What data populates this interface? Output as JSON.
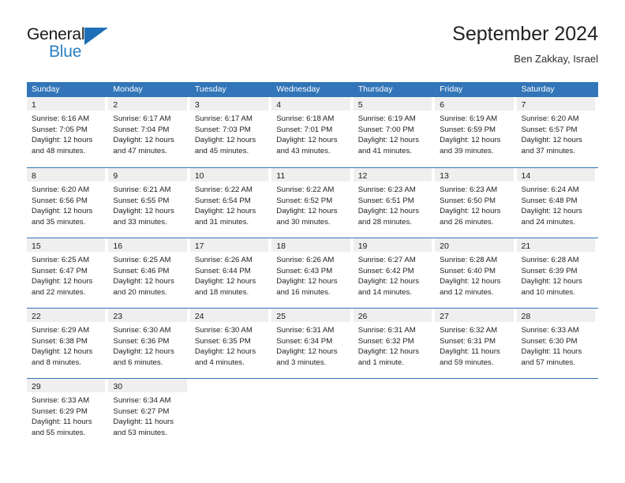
{
  "logo": {
    "word_top": "General",
    "word_bottom": "Blue",
    "triangle_color": "#1e6fb8",
    "blue_text_color": "#2980c4"
  },
  "header": {
    "title": "September 2024",
    "subtitle": "Ben Zakkay, Israel"
  },
  "theme": {
    "header_blue": "#3275b8",
    "daynum_band": "#efefef",
    "text": "#222222"
  },
  "calendar": {
    "day_headers": [
      "Sunday",
      "Monday",
      "Tuesday",
      "Wednesday",
      "Thursday",
      "Friday",
      "Saturday"
    ],
    "weeks": [
      [
        {
          "day": "1",
          "lines": [
            "Sunrise: 6:16 AM",
            "Sunset: 7:05 PM",
            "Daylight: 12 hours",
            "and 48 minutes."
          ]
        },
        {
          "day": "2",
          "lines": [
            "Sunrise: 6:17 AM",
            "Sunset: 7:04 PM",
            "Daylight: 12 hours",
            "and 47 minutes."
          ]
        },
        {
          "day": "3",
          "lines": [
            "Sunrise: 6:17 AM",
            "Sunset: 7:03 PM",
            "Daylight: 12 hours",
            "and 45 minutes."
          ]
        },
        {
          "day": "4",
          "lines": [
            "Sunrise: 6:18 AM",
            "Sunset: 7:01 PM",
            "Daylight: 12 hours",
            "and 43 minutes."
          ]
        },
        {
          "day": "5",
          "lines": [
            "Sunrise: 6:19 AM",
            "Sunset: 7:00 PM",
            "Daylight: 12 hours",
            "and 41 minutes."
          ]
        },
        {
          "day": "6",
          "lines": [
            "Sunrise: 6:19 AM",
            "Sunset: 6:59 PM",
            "Daylight: 12 hours",
            "and 39 minutes."
          ]
        },
        {
          "day": "7",
          "lines": [
            "Sunrise: 6:20 AM",
            "Sunset: 6:57 PM",
            "Daylight: 12 hours",
            "and 37 minutes."
          ]
        }
      ],
      [
        {
          "day": "8",
          "lines": [
            "Sunrise: 6:20 AM",
            "Sunset: 6:56 PM",
            "Daylight: 12 hours",
            "and 35 minutes."
          ]
        },
        {
          "day": "9",
          "lines": [
            "Sunrise: 6:21 AM",
            "Sunset: 6:55 PM",
            "Daylight: 12 hours",
            "and 33 minutes."
          ]
        },
        {
          "day": "10",
          "lines": [
            "Sunrise: 6:22 AM",
            "Sunset: 6:54 PM",
            "Daylight: 12 hours",
            "and 31 minutes."
          ]
        },
        {
          "day": "11",
          "lines": [
            "Sunrise: 6:22 AM",
            "Sunset: 6:52 PM",
            "Daylight: 12 hours",
            "and 30 minutes."
          ]
        },
        {
          "day": "12",
          "lines": [
            "Sunrise: 6:23 AM",
            "Sunset: 6:51 PM",
            "Daylight: 12 hours",
            "and 28 minutes."
          ]
        },
        {
          "day": "13",
          "lines": [
            "Sunrise: 6:23 AM",
            "Sunset: 6:50 PM",
            "Daylight: 12 hours",
            "and 26 minutes."
          ]
        },
        {
          "day": "14",
          "lines": [
            "Sunrise: 6:24 AM",
            "Sunset: 6:48 PM",
            "Daylight: 12 hours",
            "and 24 minutes."
          ]
        }
      ],
      [
        {
          "day": "15",
          "lines": [
            "Sunrise: 6:25 AM",
            "Sunset: 6:47 PM",
            "Daylight: 12 hours",
            "and 22 minutes."
          ]
        },
        {
          "day": "16",
          "lines": [
            "Sunrise: 6:25 AM",
            "Sunset: 6:46 PM",
            "Daylight: 12 hours",
            "and 20 minutes."
          ]
        },
        {
          "day": "17",
          "lines": [
            "Sunrise: 6:26 AM",
            "Sunset: 6:44 PM",
            "Daylight: 12 hours",
            "and 18 minutes."
          ]
        },
        {
          "day": "18",
          "lines": [
            "Sunrise: 6:26 AM",
            "Sunset: 6:43 PM",
            "Daylight: 12 hours",
            "and 16 minutes."
          ]
        },
        {
          "day": "19",
          "lines": [
            "Sunrise: 6:27 AM",
            "Sunset: 6:42 PM",
            "Daylight: 12 hours",
            "and 14 minutes."
          ]
        },
        {
          "day": "20",
          "lines": [
            "Sunrise: 6:28 AM",
            "Sunset: 6:40 PM",
            "Daylight: 12 hours",
            "and 12 minutes."
          ]
        },
        {
          "day": "21",
          "lines": [
            "Sunrise: 6:28 AM",
            "Sunset: 6:39 PM",
            "Daylight: 12 hours",
            "and 10 minutes."
          ]
        }
      ],
      [
        {
          "day": "22",
          "lines": [
            "Sunrise: 6:29 AM",
            "Sunset: 6:38 PM",
            "Daylight: 12 hours",
            "and 8 minutes."
          ]
        },
        {
          "day": "23",
          "lines": [
            "Sunrise: 6:30 AM",
            "Sunset: 6:36 PM",
            "Daylight: 12 hours",
            "and 6 minutes."
          ]
        },
        {
          "day": "24",
          "lines": [
            "Sunrise: 6:30 AM",
            "Sunset: 6:35 PM",
            "Daylight: 12 hours",
            "and 4 minutes."
          ]
        },
        {
          "day": "25",
          "lines": [
            "Sunrise: 6:31 AM",
            "Sunset: 6:34 PM",
            "Daylight: 12 hours",
            "and 3 minutes."
          ]
        },
        {
          "day": "26",
          "lines": [
            "Sunrise: 6:31 AM",
            "Sunset: 6:32 PM",
            "Daylight: 12 hours",
            "and 1 minute."
          ]
        },
        {
          "day": "27",
          "lines": [
            "Sunrise: 6:32 AM",
            "Sunset: 6:31 PM",
            "Daylight: 11 hours",
            "and 59 minutes."
          ]
        },
        {
          "day": "28",
          "lines": [
            "Sunrise: 6:33 AM",
            "Sunset: 6:30 PM",
            "Daylight: 11 hours",
            "and 57 minutes."
          ]
        }
      ],
      [
        {
          "day": "29",
          "lines": [
            "Sunrise: 6:33 AM",
            "Sunset: 6:29 PM",
            "Daylight: 11 hours",
            "and 55 minutes."
          ]
        },
        {
          "day": "30",
          "lines": [
            "Sunrise: 6:34 AM",
            "Sunset: 6:27 PM",
            "Daylight: 11 hours",
            "and 53 minutes."
          ]
        },
        {
          "day": "",
          "lines": []
        },
        {
          "day": "",
          "lines": []
        },
        {
          "day": "",
          "lines": []
        },
        {
          "day": "",
          "lines": []
        },
        {
          "day": "",
          "lines": []
        }
      ]
    ]
  }
}
